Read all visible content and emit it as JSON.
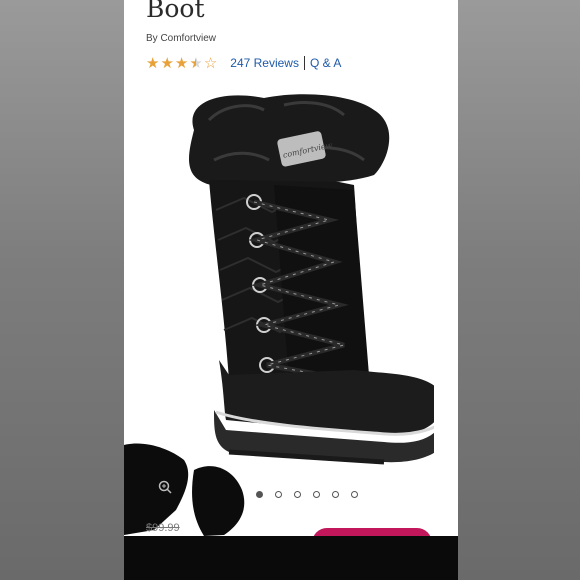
{
  "product": {
    "title": "Boot",
    "brand": "By Comfortview",
    "rating": 3.5,
    "rating_max": 5,
    "reviews_label": "247 Reviews",
    "qa_label": "Q & A",
    "old_price": "$99.99",
    "boot_logo_text": "comfortview"
  },
  "gallery": {
    "image_count": 6,
    "active_index": 0
  },
  "colors": {
    "stars": "#e8a23a",
    "link": "#1e5aa8",
    "accent": "#c2185b"
  },
  "icons": {
    "zoom": "magnifier-icon"
  }
}
